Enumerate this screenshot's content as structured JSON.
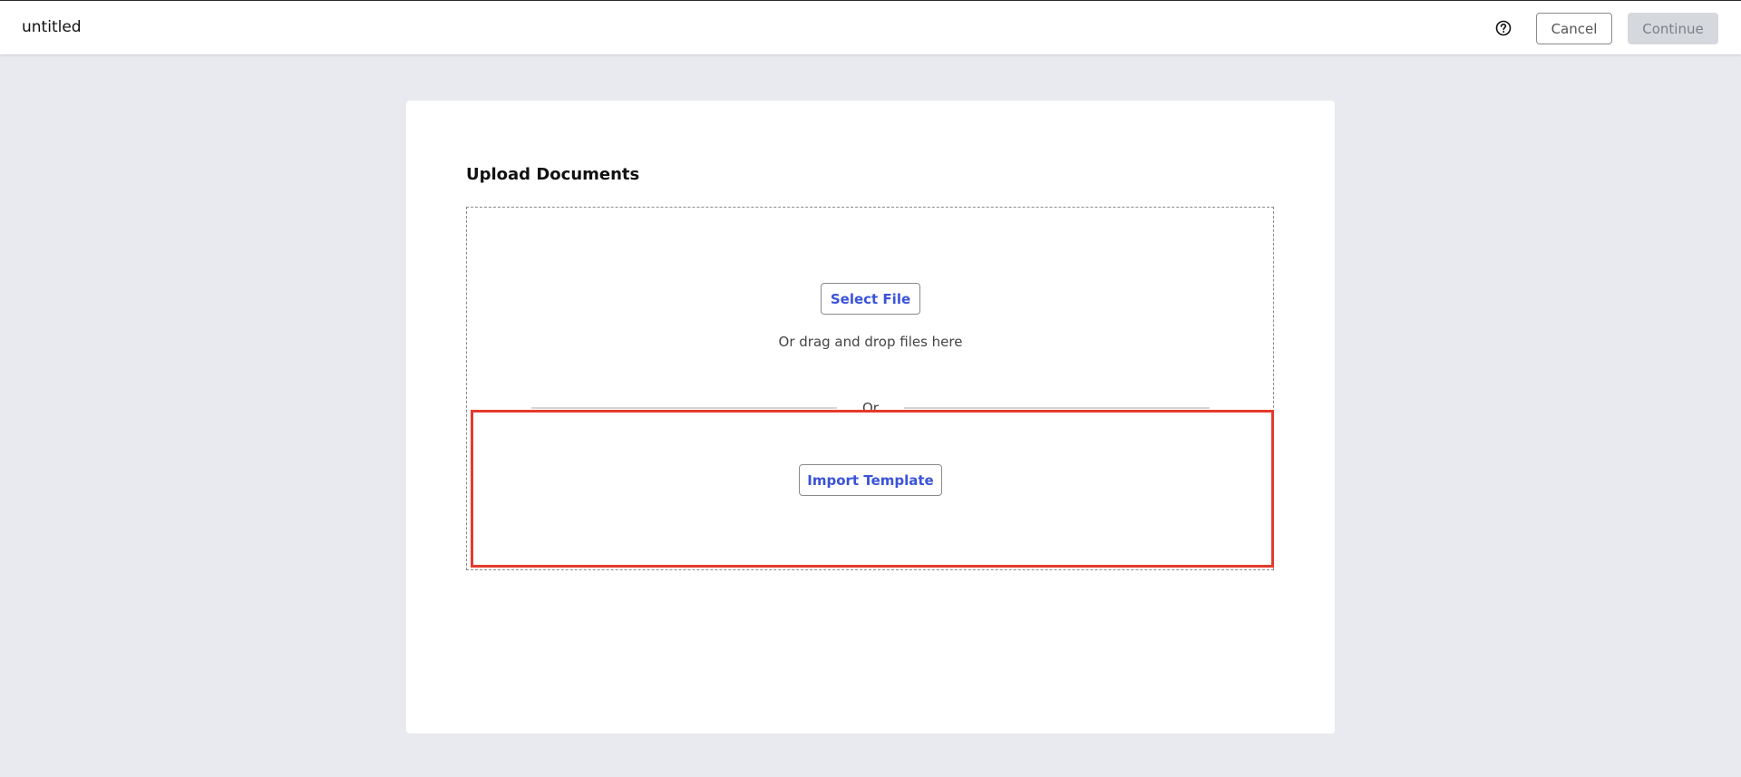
{
  "header": {
    "document_title": "untitled",
    "help_icon": "question-circle-icon",
    "cancel_label": "Cancel",
    "continue_label": "Continue"
  },
  "upload": {
    "title": "Upload Documents",
    "select_file_label": "Select File",
    "drag_drop_text": "Or drag and drop files here",
    "or_separator": "Or",
    "import_template_label": "Import Template"
  },
  "colors": {
    "accent": "#3a53d8",
    "highlight": "#e43a2e",
    "background": "#e9eaef",
    "disabled_button": "#d5d8dd"
  }
}
